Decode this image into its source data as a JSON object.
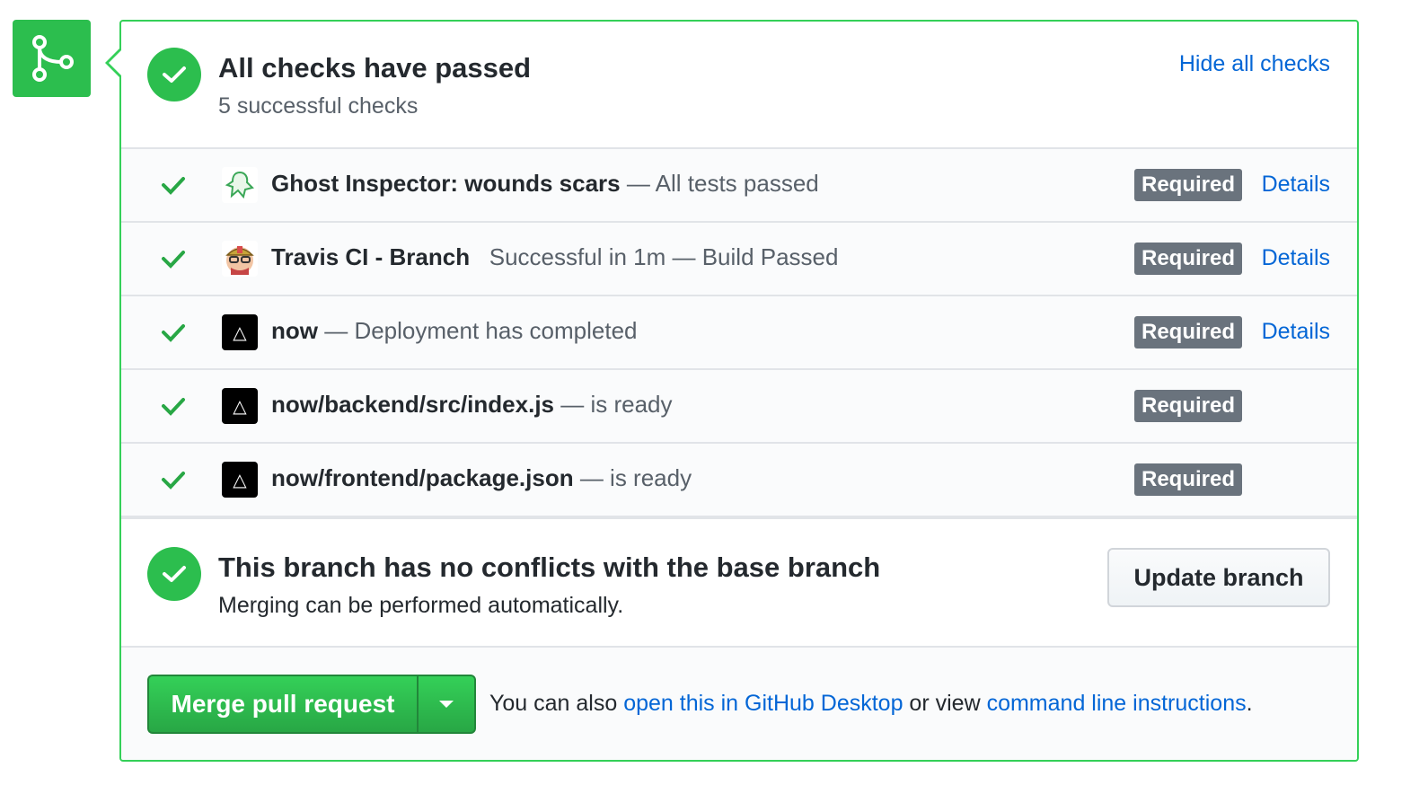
{
  "merge_icon": {
    "name": "git-merge-icon",
    "color": "#2cbe4e"
  },
  "summary": {
    "title": "All checks have passed",
    "subtitle": "5 successful checks",
    "hide_link": "Hide all checks"
  },
  "checks": [
    {
      "name": "Ghost Inspector: wounds scars",
      "desc": " — All tests passed",
      "badge": "Required",
      "details": "Details",
      "avatar": "ghost-inspector-icon"
    },
    {
      "name": "Travis CI - Branch",
      "desc": "   Successful in 1m — Build Passed",
      "badge": "Required",
      "details": "Details",
      "avatar": "travis-ci-icon"
    },
    {
      "name": "now",
      "desc": " — Deployment has completed",
      "badge": "Required",
      "details": "Details",
      "avatar": "now-icon",
      "avatar_glyph": "△"
    },
    {
      "name": "now/backend/src/index.js",
      "desc": " — is ready",
      "badge": "Required",
      "avatar": "now-icon",
      "avatar_glyph": "△"
    },
    {
      "name": "now/frontend/package.json",
      "desc": " — is ready",
      "badge": "Required",
      "avatar": "now-icon",
      "avatar_glyph": "△"
    }
  ],
  "conflicts": {
    "title": "This branch has no conflicts with the base branch",
    "subtitle": "Merging can be performed automatically.",
    "update_button": "Update branch"
  },
  "merge": {
    "button": "Merge pull request",
    "hint_prefix": "You can also ",
    "hint_link1": "open this in GitHub Desktop",
    "hint_middle": " or view ",
    "hint_link2": "command line instructions",
    "hint_suffix": "."
  },
  "colors": {
    "success": "#2cbe4e",
    "link": "#0366d6",
    "badge": "#6a737d"
  }
}
